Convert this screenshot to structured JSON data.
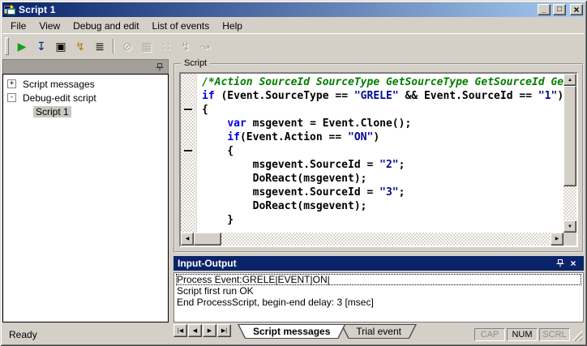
{
  "window": {
    "title": "Script 1",
    "minimize_glyph": "_",
    "maximize_glyph": "□",
    "close_glyph": "×"
  },
  "menu": {
    "items": [
      "File",
      "View",
      "Debug and edit",
      "List of events",
      "Help"
    ]
  },
  "toolbar": {
    "items": [
      {
        "name": "run-script-button",
        "glyph": "▶",
        "color": "#189c18",
        "enabled": true
      },
      {
        "name": "save-list-button",
        "glyph": "↧",
        "color": "#00258c",
        "enabled": true
      },
      {
        "name": "save-button",
        "glyph": "▣",
        "color": "#000000",
        "enabled": true
      },
      {
        "name": "script-event-button",
        "glyph": "↯",
        "color": "#b08000",
        "enabled": true
      },
      {
        "name": "text-lines-button",
        "glyph": "≣",
        "color": "#000000",
        "enabled": true
      },
      {
        "separator": true
      },
      {
        "name": "erase-button",
        "glyph": "⊘",
        "color": "#a9a59c",
        "enabled": false
      },
      {
        "name": "grid-button",
        "glyph": "▦",
        "color": "#a9a59c",
        "enabled": false
      },
      {
        "name": "dice-button",
        "glyph": "∷",
        "color": "#a9a59c",
        "enabled": false
      },
      {
        "name": "event-filter-button",
        "glyph": "↯",
        "color": "#a9a59c",
        "enabled": false
      },
      {
        "name": "event-edit-button",
        "glyph": "↝",
        "color": "#a9a59c",
        "enabled": false
      }
    ]
  },
  "sidebar": {
    "tree": [
      {
        "label": "Script messages",
        "expander": "+",
        "level": 0,
        "selected": false
      },
      {
        "label": "Debug-edit script",
        "expander": "-",
        "level": 0,
        "selected": false
      },
      {
        "label": "Script 1",
        "expander": "",
        "level": 1,
        "selected": true
      }
    ]
  },
  "script_panel": {
    "title": "Script",
    "brace_marker_lines": [
      3,
      6
    ],
    "scroll": {
      "up": "▲",
      "down": "▼",
      "left": "◀",
      "right": "▶"
    },
    "code_lines": [
      [
        {
          "t": "/*Action SourceId SourceType GetSourceType GetSourceId Ge",
          "c": "com"
        }
      ],
      [
        {
          "t": "if ",
          "c": "kw"
        },
        {
          "t": "(Event.SourceType == ",
          "c": "pl"
        },
        {
          "t": "\"GRELE\"",
          "c": "str"
        },
        {
          "t": " && Event.SourceId == ",
          "c": "pl"
        },
        {
          "t": "\"1\"",
          "c": "str"
        },
        {
          "t": ")",
          "c": "pl"
        }
      ],
      [
        {
          "t": "{",
          "c": "pl"
        }
      ],
      [
        {
          "t": "    ",
          "c": "pl"
        },
        {
          "t": "var",
          "c": "kw"
        },
        {
          "t": " msgevent = Event.Clone();",
          "c": "pl"
        }
      ],
      [
        {
          "t": "    ",
          "c": "pl"
        },
        {
          "t": "if",
          "c": "kw"
        },
        {
          "t": "(Event.Action == ",
          "c": "pl"
        },
        {
          "t": "\"ON\"",
          "c": "str"
        },
        {
          "t": ")",
          "c": "pl"
        }
      ],
      [
        {
          "t": "    {",
          "c": "pl"
        }
      ],
      [
        {
          "t": "        msgevent.SourceId = ",
          "c": "pl"
        },
        {
          "t": "\"2\"",
          "c": "str"
        },
        {
          "t": ";",
          "c": "pl"
        }
      ],
      [
        {
          "t": "        DoReact(msgevent);",
          "c": "pl"
        }
      ],
      [
        {
          "t": "        msgevent.SourceId = ",
          "c": "pl"
        },
        {
          "t": "\"3\"",
          "c": "str"
        },
        {
          "t": ";",
          "c": "pl"
        }
      ],
      [
        {
          "t": "        DoReact(msgevent);",
          "c": "pl"
        }
      ],
      [
        {
          "t": "    }",
          "c": "pl"
        }
      ]
    ]
  },
  "output_panel": {
    "title": "Input-Output",
    "close_glyph": "×",
    "lines": [
      "Process Event:GRELE|EVENT|ON|",
      "Script first run OK",
      "End ProcessScript, begin-end delay: 3 [msec]"
    ],
    "selected_line": 0,
    "nav": [
      "|◀",
      "◀",
      "▶",
      "▶|"
    ],
    "tabs": [
      {
        "label": "Script messages",
        "active": true
      },
      {
        "label": "Trial event",
        "active": false
      }
    ]
  },
  "status_bar": {
    "message": "Ready",
    "indicators": [
      {
        "label": "CAP",
        "active": false
      },
      {
        "label": "NUM",
        "active": true
      },
      {
        "label": "SCRL",
        "active": false
      }
    ]
  },
  "colors": {
    "chrome": "#d4d0c8",
    "titlebar_gradient_start": "#0a246a",
    "titlebar_gradient_end": "#a6caf0",
    "output_header": "#0a246a",
    "comment_green": "#007d00",
    "keyword_blue": "#0000e6",
    "string_navy": "#000a8f",
    "tree_selected_bg": "#cac7c0"
  }
}
